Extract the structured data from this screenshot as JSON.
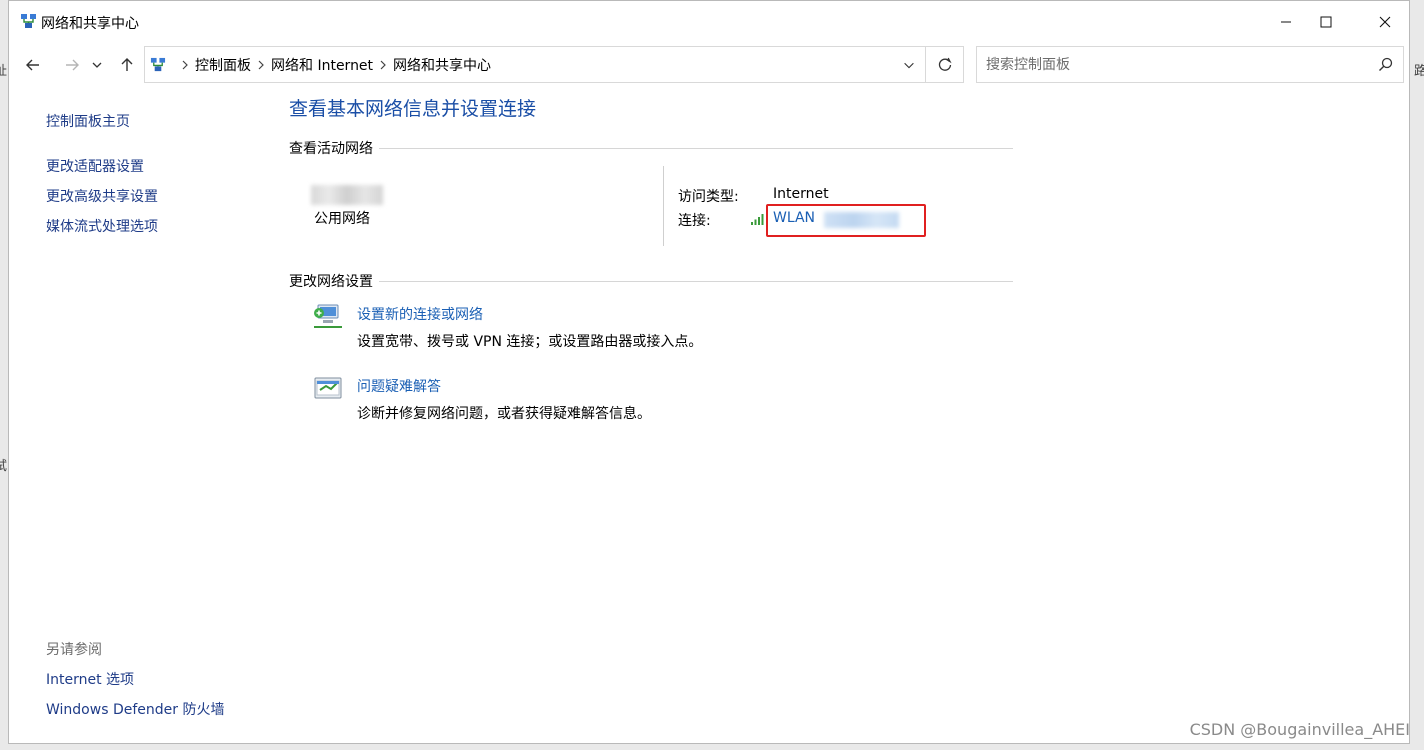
{
  "window": {
    "title": "网络和共享中心"
  },
  "address_bar": {
    "breadcrumbs": [
      "控制面板",
      "网络和 Internet",
      "网络和共享中心"
    ]
  },
  "search": {
    "placeholder": "搜索控制面板"
  },
  "sidebar": {
    "home": "控制面板主页",
    "items": [
      "更改适配器设置",
      "更改高级共享设置",
      "媒体流式处理选项"
    ],
    "see_also_title": "另请参阅",
    "see_also": [
      "Internet 选项",
      "Windows Defender 防火墙"
    ]
  },
  "main": {
    "title": "查看基本网络信息并设置连接",
    "active_networks_heading": "查看活动网络",
    "network": {
      "type": "公用网络",
      "access_type_label": "访问类型:",
      "access_type_value": "Internet",
      "connection_label": "连接:",
      "connection_value": "WLAN"
    },
    "change_settings_heading": "更改网络设置",
    "tasks": [
      {
        "link": "设置新的连接或网络",
        "desc": "设置宽带、拨号或 VPN 连接；或设置路由器或接入点。"
      },
      {
        "link": "问题疑难解答",
        "desc": "诊断并修复网络问题，或者获得疑难解答信息。"
      }
    ]
  },
  "background": {
    "left_fragment_1": "址",
    "left_fragment_2": "试",
    "right_fragment": "路"
  },
  "watermark": "CSDN @Bougainvillea_AHEI",
  "colors": {
    "link": "#1a5fb4",
    "title": "#1a4ea6",
    "highlight": "#e02020"
  }
}
